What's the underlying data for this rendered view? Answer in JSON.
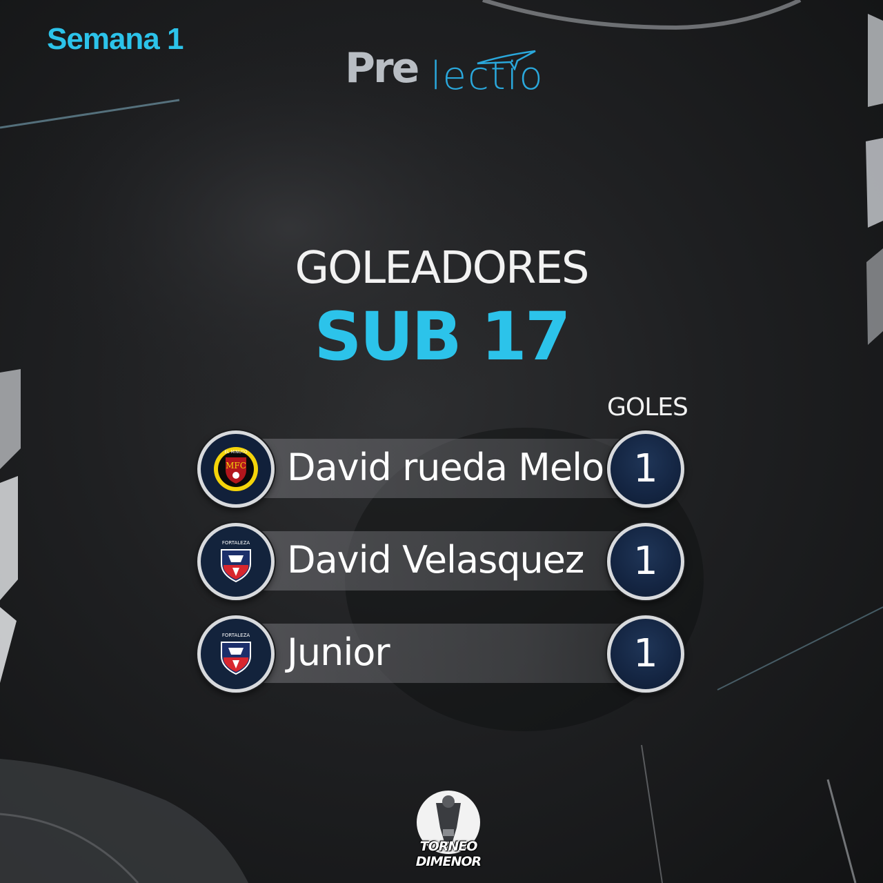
{
  "week": "Semana 1",
  "brand": {
    "pre": "Pre",
    "lectio": "lectio"
  },
  "title": "GOLEADORES",
  "category": "SUB 17",
  "goals_header": "GOLES",
  "scorers": [
    {
      "name": "David rueda Melo",
      "goals": "1",
      "club": "El Minuto FC",
      "badge_text": "EL MINUTO",
      "badge_initials": "MFC"
    },
    {
      "name": "David Velasquez",
      "goals": "1",
      "club": "Fortaleza",
      "badge_text": "FORTALEZA"
    },
    {
      "name": "Junior",
      "goals": "1",
      "club": "Fortaleza",
      "badge_text": "FORTALEZA"
    }
  ],
  "tournament": "TORNEO DIMENOR",
  "colors": {
    "accent": "#2cc3ea",
    "text": "#ffffff",
    "badge_navy": "#13233c",
    "brand_blue": "#2aa8dc"
  }
}
